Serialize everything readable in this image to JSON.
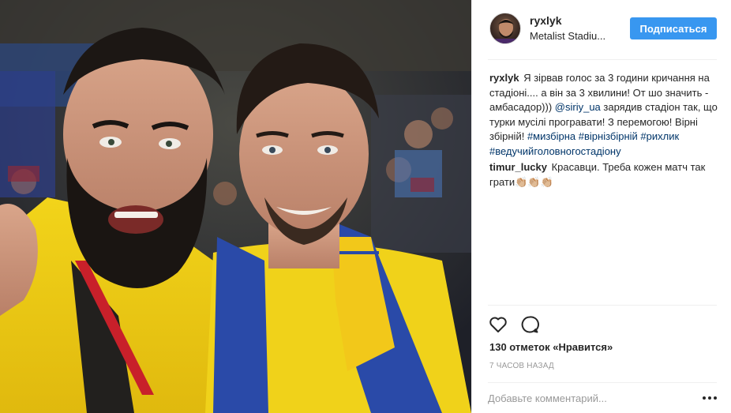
{
  "post": {
    "username": "ryxlyk",
    "location": "Metalist Stadiu...",
    "follow_label": "Подписаться",
    "caption": {
      "user": "ryxlyk",
      "text_1": "Я зірвав голос за 3 години кричання на стадіоні.... а він за 3 хвилини! От шо значить - амбасадор))) ",
      "mention": "@siriy_ua",
      "text_2": " зарядив стадіон так, що турки мусілі програвати! З перемогою! Вірні збірній! ",
      "tags": "#мизбірна #вірнізбірній #рихлик #ведучийголовногостадіону"
    },
    "comments": [
      {
        "user": "timur_lucky",
        "text": "Красавци. Треба кожен матч так грати👏🏼👏🏼👏🏼"
      }
    ],
    "likes_text": "130 отметок «Нравится»",
    "time_text": "7 ЧАСОВ НАЗАД",
    "comment_placeholder": "Добавьте комментарий..."
  },
  "icons": {
    "like": "heart-icon",
    "comment": "comment-bubble-icon",
    "more": "ellipsis-icon"
  },
  "colors": {
    "follow_button": "#3897f0",
    "link": "#003569",
    "muted": "#999999",
    "divider": "#efefef"
  }
}
